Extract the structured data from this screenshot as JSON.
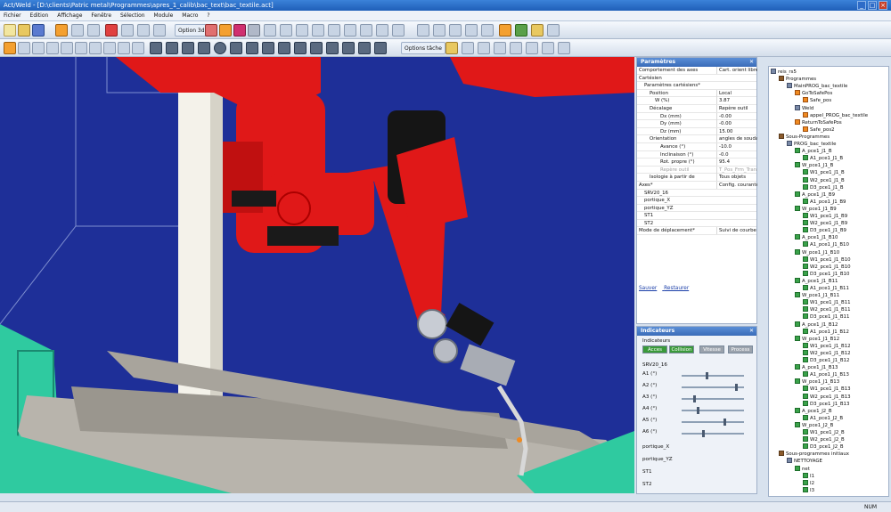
{
  "window": {
    "title": "Act/Weld - [D:\\clients\\Patric metal\\Programmes\\apres_1_calib\\bac_text\\bac_textile.act]"
  },
  "menu": [
    "Fichier",
    "Edition",
    "Affichage",
    "Fenêtre",
    "Sélection",
    "Module",
    "Macro",
    "?"
  ],
  "toolbar": {
    "option3d": "Option 3d",
    "options_tache": "Options tâche"
  },
  "params": {
    "title": "Paramètres",
    "rows": [
      {
        "k": "Comportement des axes",
        "v": "Cart. orient libre (",
        "indent": 0
      },
      {
        "k": "Cartésien",
        "v": "",
        "indent": 0
      },
      {
        "k": "Paramètres cartésiens*",
        "v": "",
        "indent": 1
      },
      {
        "k": "Position",
        "v": "Local",
        "indent": 2
      },
      {
        "k": "W (%)",
        "v": "3.87",
        "indent": 3
      },
      {
        "k": "Décalage",
        "v": "Repère outil",
        "indent": 2
      },
      {
        "k": "Dx (mm)",
        "v": "-0.00",
        "indent": 4
      },
      {
        "k": "Dy (mm)",
        "v": "-0.00",
        "indent": 4
      },
      {
        "k": "Dz (mm)",
        "v": "15.00",
        "indent": 4
      },
      {
        "k": "Orientation",
        "v": "angles de soudag",
        "indent": 2
      },
      {
        "k": "Avance (°)",
        "v": "-10.0",
        "indent": 4
      },
      {
        "k": "Inclinaison (°)",
        "v": "-0.0",
        "indent": 4
      },
      {
        "k": "Rot. propre (°)",
        "v": "95.4",
        "indent": 4
      },
      {
        "k": "Repère outil",
        "v": "T_Pos_Frm_Trans",
        "indent": 4,
        "dim": true
      },
      {
        "k": "Isologie à partir de",
        "v": "Tous objets",
        "indent": 2
      },
      {
        "k": "Axes*",
        "v": "Config. courante",
        "indent": 0
      },
      {
        "k": "SRV20_16",
        "v": "",
        "indent": 1
      },
      {
        "k": "portique_X",
        "v": "",
        "indent": 1
      },
      {
        "k": "portique_YZ",
        "v": "",
        "indent": 1
      },
      {
        "k": "ST1",
        "v": "",
        "indent": 1
      },
      {
        "k": "ST2",
        "v": "",
        "indent": 1
      },
      {
        "k": "Mode de déplacement*",
        "v": "Suivi de courbe",
        "indent": 0
      }
    ],
    "save": "Sauver",
    "restore": "Restaurer"
  },
  "indicators": {
    "title": "Indicateurs",
    "group": "Indicateurs",
    "buttons": [
      "Acces",
      "Collision",
      "Vitesse",
      "Process"
    ],
    "robot": "SRV20_16",
    "axes": [
      {
        "label": "A1 (°)",
        "level": 0.4
      },
      {
        "label": "A2 (°)",
        "level": 0.9
      },
      {
        "label": "A3 (°)",
        "level": 0.2
      },
      {
        "label": "A4 (°)",
        "level": 0.25
      },
      {
        "label": "A5 (°)",
        "level": 0.7
      },
      {
        "label": "A6 (°)",
        "level": 0.35
      }
    ],
    "groups": [
      "portique_X",
      "portique_YZ",
      "ST1",
      "ST2"
    ]
  },
  "tree": {
    "items": [
      {
        "label": "reis_rs5",
        "indent": 0,
        "icon": "b"
      },
      {
        "label": "Programmes",
        "indent": 1,
        "icon": "f"
      },
      {
        "label": "MainPROG_bac_textile",
        "indent": 2,
        "icon": "b"
      },
      {
        "label": "GoToSafePos",
        "indent": 3,
        "icon": "o"
      },
      {
        "label": "Safe_pos",
        "indent": 4,
        "icon": "o"
      },
      {
        "label": "Weld",
        "indent": 3,
        "icon": "b"
      },
      {
        "label": "appel_PROG_bac_textile",
        "indent": 4,
        "icon": "o"
      },
      {
        "label": "ReturnToSafePos",
        "indent": 3,
        "icon": "o"
      },
      {
        "label": "Safe_pos2",
        "indent": 4,
        "icon": "o"
      },
      {
        "label": "Sous-Programmes",
        "indent": 1,
        "icon": "f"
      },
      {
        "label": "PROG_bac_textile",
        "indent": 2,
        "icon": "b"
      },
      {
        "label": "A_pce1_J1_B",
        "indent": 3,
        "icon": "g"
      },
      {
        "label": "A1_pce1_J1_B",
        "indent": 4,
        "icon": "g"
      },
      {
        "label": "W_pce1_J1_B",
        "indent": 3,
        "icon": "g"
      },
      {
        "label": "W1_pce1_J1_B",
        "indent": 4,
        "icon": "g"
      },
      {
        "label": "W2_pce1_J1_B",
        "indent": 4,
        "icon": "g"
      },
      {
        "label": "D3_pce1_J1_B",
        "indent": 4,
        "icon": "g"
      },
      {
        "label": "A_pce1_J1_B9",
        "indent": 3,
        "icon": "g"
      },
      {
        "label": "A1_pce1_J1_B9",
        "indent": 4,
        "icon": "g"
      },
      {
        "label": "W_pce1_J1_B9",
        "indent": 3,
        "icon": "g"
      },
      {
        "label": "W1_pce1_J1_B9",
        "indent": 4,
        "icon": "g"
      },
      {
        "label": "W2_pce1_J1_B9",
        "indent": 4,
        "icon": "g"
      },
      {
        "label": "D3_pce1_J1_B9",
        "indent": 4,
        "icon": "g"
      },
      {
        "label": "A_pce1_J1_B10",
        "indent": 3,
        "icon": "g"
      },
      {
        "label": "A1_pce1_J1_B10",
        "indent": 4,
        "icon": "g"
      },
      {
        "label": "W_pce1_J1_B10",
        "indent": 3,
        "icon": "g"
      },
      {
        "label": "W1_pce1_J1_B10",
        "indent": 4,
        "icon": "g"
      },
      {
        "label": "W2_pce1_J1_B10",
        "indent": 4,
        "icon": "g"
      },
      {
        "label": "D3_pce1_J1_B10",
        "indent": 4,
        "icon": "g"
      },
      {
        "label": "A_pce1_J1_B11",
        "indent": 3,
        "icon": "g"
      },
      {
        "label": "A1_pce1_J1_B11",
        "indent": 4,
        "icon": "g"
      },
      {
        "label": "W_pce1_J1_B11",
        "indent": 3,
        "icon": "g"
      },
      {
        "label": "W1_pce1_J1_B11",
        "indent": 4,
        "icon": "g"
      },
      {
        "label": "W2_pce1_J1_B11",
        "indent": 4,
        "icon": "g"
      },
      {
        "label": "D3_pce1_J1_B11",
        "indent": 4,
        "icon": "g"
      },
      {
        "label": "A_pce1_J1_B12",
        "indent": 3,
        "icon": "g"
      },
      {
        "label": "A1_pce1_J1_B12",
        "indent": 4,
        "icon": "g"
      },
      {
        "label": "W_pce1_J1_B12",
        "indent": 3,
        "icon": "g"
      },
      {
        "label": "W1_pce1_J1_B12",
        "indent": 4,
        "icon": "g"
      },
      {
        "label": "W2_pce1_J1_B12",
        "indent": 4,
        "icon": "g"
      },
      {
        "label": "D3_pce1_J1_B12",
        "indent": 4,
        "icon": "g"
      },
      {
        "label": "A_pce1_J1_B13",
        "indent": 3,
        "icon": "g"
      },
      {
        "label": "A1_pce1_J1_B13",
        "indent": 4,
        "icon": "g"
      },
      {
        "label": "W_pce1_J1_B13",
        "indent": 3,
        "icon": "g"
      },
      {
        "label": "W1_pce1_J1_B13",
        "indent": 4,
        "icon": "g"
      },
      {
        "label": "W2_pce1_J1_B13",
        "indent": 4,
        "icon": "g"
      },
      {
        "label": "D3_pce1_J1_B13",
        "indent": 4,
        "icon": "g"
      },
      {
        "label": "A_pce1_J2_B",
        "indent": 3,
        "icon": "g"
      },
      {
        "label": "A1_pce1_J2_B",
        "indent": 4,
        "icon": "g"
      },
      {
        "label": "W_pce1_J2_B",
        "indent": 3,
        "icon": "g"
      },
      {
        "label": "W1_pce1_J2_B",
        "indent": 4,
        "icon": "g"
      },
      {
        "label": "W2_pce1_J2_B",
        "indent": 4,
        "icon": "g"
      },
      {
        "label": "D3_pce1_J2_B",
        "indent": 4,
        "icon": "g"
      },
      {
        "label": "Sous-programmes initiaux",
        "indent": 1,
        "icon": "f"
      },
      {
        "label": "NETTOYAGE",
        "indent": 2,
        "icon": "b"
      },
      {
        "label": "net",
        "indent": 3,
        "icon": "g"
      },
      {
        "label": "I1",
        "indent": 4,
        "icon": "g"
      },
      {
        "label": "I2",
        "indent": 4,
        "icon": "g"
      },
      {
        "label": "I3",
        "indent": 4,
        "icon": "g"
      }
    ]
  },
  "status": {
    "mode": "NUM"
  }
}
